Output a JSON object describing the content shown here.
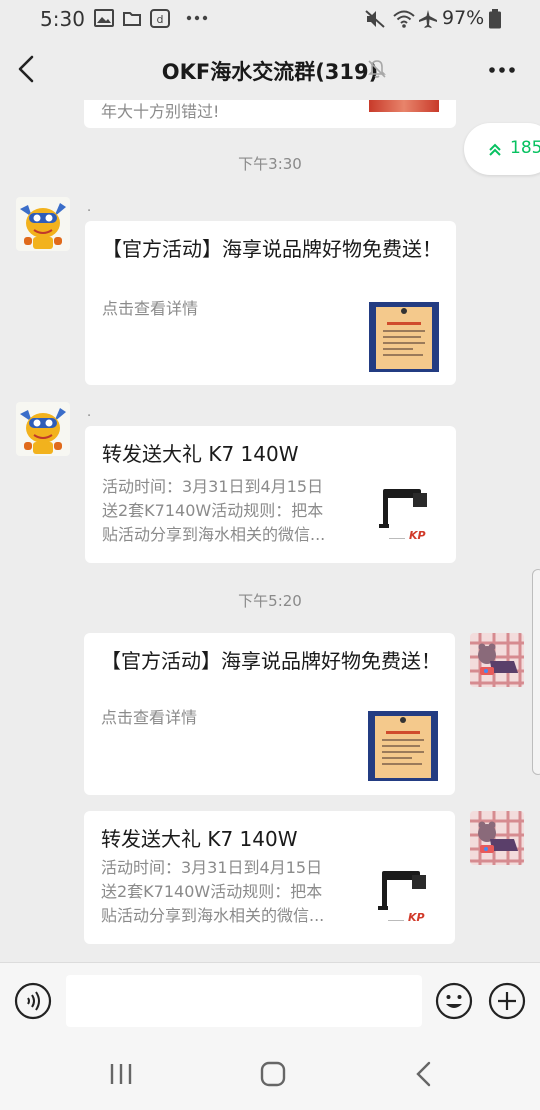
{
  "status_bar": {
    "time": "5:30",
    "battery": "97%",
    "left_icons": [
      "image-icon",
      "folder-icon",
      "d-app-icon",
      "more-dots-icon"
    ],
    "right_icons": [
      "mute-icon",
      "wifi-icon",
      "airplane-icon",
      "battery-icon"
    ]
  },
  "header": {
    "title": "OKF海水交流群(319)",
    "icons": [
      "back-icon",
      "muted-bell-icon",
      "more-icon"
    ]
  },
  "unread": {
    "count": "185"
  },
  "partial_top": {
    "text": "年大十方别错过!"
  },
  "timestamps": [
    "下午3:30",
    "下午5:20"
  ],
  "messages": [
    {
      "sender": ".",
      "title": "【官方活动】海享说品牌好物免费送！",
      "desc": "点击查看详情",
      "thumb": "poster-thumbnail",
      "side": "left"
    },
    {
      "sender": ".",
      "title": "转发送大礼 K7 140W",
      "desc_lines": [
        "活动时间：3月31日到4月15日",
        "送2套K7140W活动规则：把本",
        "贴活动分享到海水相关的微信..."
      ],
      "thumb": "lamp-thumbnail",
      "side": "left"
    },
    {
      "title": "【官方活动】海享说品牌好物免费送！",
      "desc": "点击查看详情",
      "thumb": "poster-thumbnail",
      "side": "right"
    },
    {
      "title": "转发送大礼 K7 140W",
      "desc_lines": [
        "活动时间：3月31日到4月15日",
        "送2套K7140W活动规则：把本",
        "贴活动分享到海水相关的微信..."
      ],
      "thumb": "lamp-thumbnail",
      "side": "right"
    }
  ],
  "input_bar": {
    "placeholder": "",
    "icons": [
      "voice-icon",
      "emoji-icon",
      "plus-icon"
    ]
  },
  "nav_bar": {
    "icons": [
      "recents-icon",
      "home-icon",
      "back-nav-icon"
    ]
  },
  "colors": {
    "background": "#ededed",
    "card": "#ffffff",
    "accent_green": "#07c160",
    "thumb_frame": "#233c82",
    "thumb_paper": "#f4c98c"
  }
}
